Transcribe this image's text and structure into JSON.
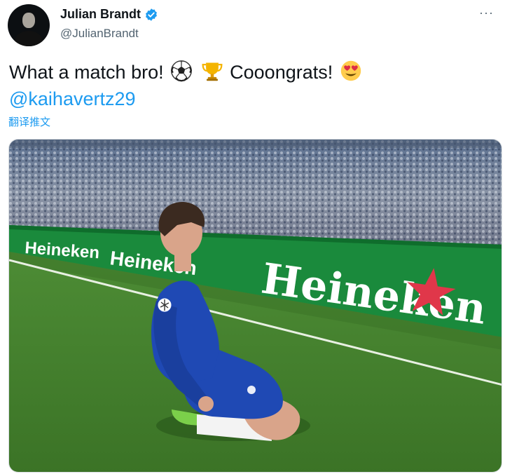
{
  "tweet": {
    "display_name": "Julian Brandt",
    "handle": "@JulianBrandt",
    "text_part1": "What a match bro!",
    "text_part2": "Cooongrats!",
    "mention": "@kaihavertz29",
    "translate_label": "翻译推文",
    "more_label": "···"
  },
  "icons": {
    "verified": "verified-badge-icon",
    "soccer_ball": "soccer-ball-emoji",
    "trophy": "trophy-emoji",
    "heart_eyes": "heart-eyes-emoji",
    "more": "more-options-icon"
  },
  "media": {
    "board_text_main": "Heineken",
    "board_text_small": "Heineken"
  },
  "colors": {
    "link": "#1d9bf0",
    "verified": "#1d9bf0",
    "pitch": "#3f7a2b",
    "kit": "#1f49b4",
    "board": "#1a8a3c"
  }
}
